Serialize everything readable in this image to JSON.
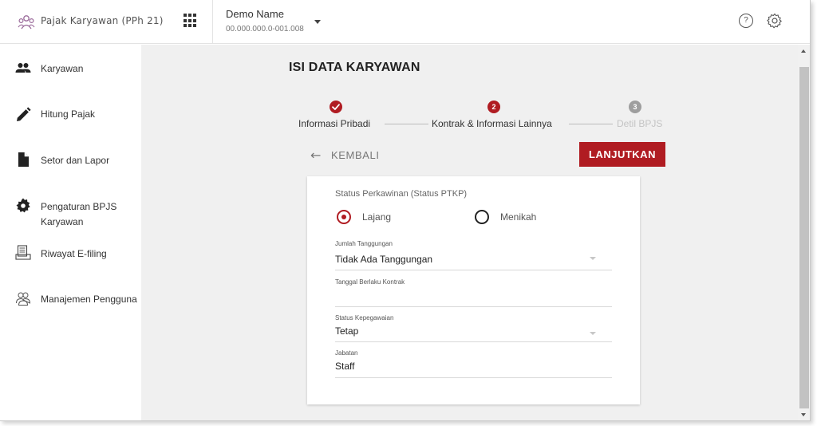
{
  "header": {
    "app_title": "Pajak Karyawan (PPh 21)",
    "company_name": "Demo Name",
    "company_npwp": "00.000.000.0-001.008",
    "help_glyph": "?"
  },
  "sidebar": {
    "items": [
      {
        "label": "Karyawan",
        "icon": "people-icon"
      },
      {
        "label": "Hitung Pajak",
        "icon": "pencil-icon"
      },
      {
        "label": "Setor dan Lapor",
        "icon": "document-icon"
      },
      {
        "label": "Pengaturan BPJS Karyawan",
        "icon": "gear-icon"
      },
      {
        "label": "Riwayat E-filing",
        "icon": "efiling-icon"
      },
      {
        "label": "Manajemen Pengguna",
        "icon": "users-icon"
      }
    ]
  },
  "page": {
    "title": "ISI DATA KARYAWAN",
    "back_label": "KEMBALI",
    "next_label": "LANJUTKAN"
  },
  "stepper": {
    "steps": [
      {
        "number": "1",
        "label": "Informasi Pribadi",
        "state": "done"
      },
      {
        "number": "2",
        "label": "Kontrak & Informasi Lainnya",
        "state": "active"
      },
      {
        "number": "3",
        "label": "Detil BPJS",
        "state": "pending"
      }
    ]
  },
  "form": {
    "marital_label": "Status Perkawinan (Status PTKP)",
    "marital_options": [
      {
        "label": "Lajang",
        "selected": true
      },
      {
        "label": "Menikah",
        "selected": false
      }
    ],
    "tanggungan_label": "Jumlah Tanggungan",
    "tanggungan_value": "Tidak Ada Tanggungan",
    "tanggal_label": "Tanggal Berlaku Kontrak",
    "tanggal_value": "",
    "kepegawaian_label": "Status Kepegawaian",
    "kepegawaian_value": "Tetap",
    "jabatan_label": "Jabatan",
    "jabatan_value": "Staff"
  },
  "colors": {
    "accent": "#b01c22",
    "pending": "#9e9e9e",
    "background": "#f0f0f0"
  }
}
